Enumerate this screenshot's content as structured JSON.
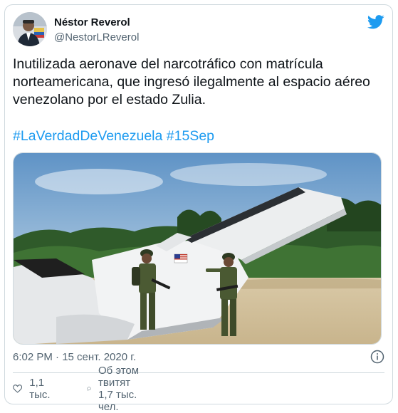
{
  "tweet": {
    "author_name": "Néstor Reverol",
    "author_handle": "@NestorLReverol",
    "text": "Inutilizada aeronave del narcotráfico con matrícula norteamericana, que ingresó ilegalmente al espacio aéreo venezolano por el estado Zulia.",
    "hashtags": [
      "#LaVerdadDeVenezuela",
      "#15Sep"
    ],
    "timestamp": "6:02 PM · 15 сент. 2020 г.",
    "likes_label": "1,1 тыс.",
    "discussion_label": "Об этом твитят 1,7 тыс. чел."
  },
  "icons": {
    "brand": "twitter-bird-icon",
    "info": "info-icon",
    "like": "heart-icon",
    "reply": "speech-bubble-icon"
  },
  "colors": {
    "accent": "#1d9bf0",
    "text": "#0f1419",
    "secondary": "#536471",
    "border": "#cfd9de"
  }
}
